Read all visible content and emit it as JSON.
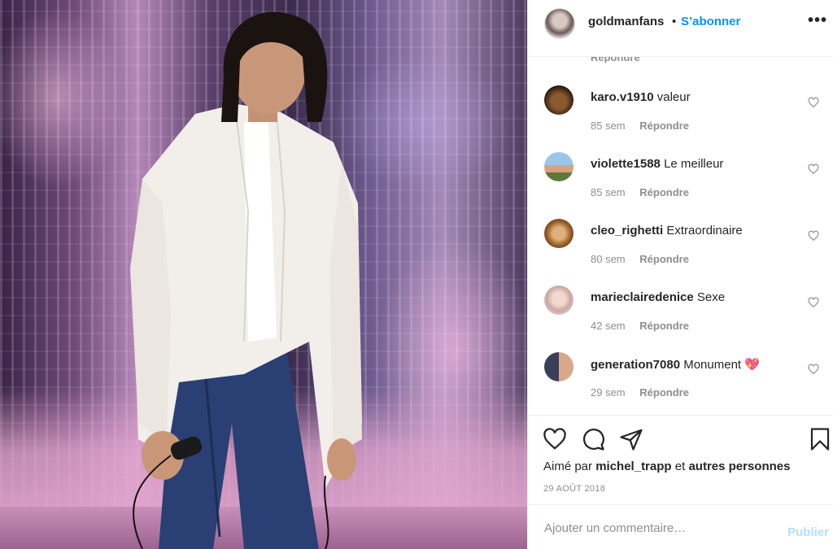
{
  "header": {
    "username": "goldmanfans",
    "separator": "•",
    "follow_label": "S’abonner",
    "more_label": "•••"
  },
  "comments": {
    "cut_reply_label": "Répondre",
    "items": [
      {
        "username": "karo.v1910",
        "text": "valeur",
        "age": "85 sem",
        "reply_label": "Répondre"
      },
      {
        "username": "violette1588",
        "text": "Le meilleur",
        "age": "85 sem",
        "reply_label": "Répondre"
      },
      {
        "username": "cleo_righetti",
        "text": "Extraordinaire",
        "age": "80 sem",
        "reply_label": "Répondre"
      },
      {
        "username": "marieclairedenice",
        "text": "Sexe",
        "age": "42 sem",
        "reply_label": "Répondre"
      },
      {
        "username": "generation7080",
        "text": "Monument 💖",
        "age": "29 sem",
        "reply_label": "Répondre"
      }
    ]
  },
  "actions": {
    "likes_prefix": "Aimé par",
    "likes_user": "michel_trapp",
    "likes_and": "et",
    "likes_others": "autres personnes",
    "date": "29 AOÛT 2018"
  },
  "compose": {
    "placeholder": "Ajouter un commentaire…",
    "publish_label": "Publier"
  },
  "colors": {
    "accent": "#0095f6",
    "publish_disabled": "#b2dffc",
    "muted": "#8e8e8e"
  }
}
